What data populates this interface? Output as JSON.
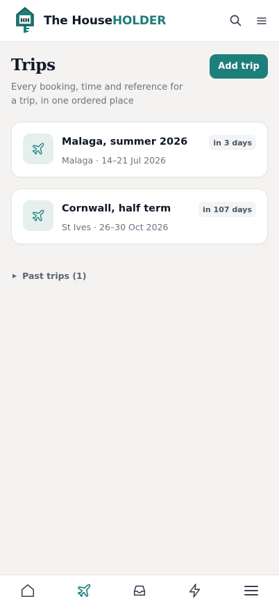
{
  "header": {
    "brand_part1": "The House",
    "brand_part2": "HOLDER",
    "logo_letters": "HH",
    "icons": [
      "search-icon",
      "menu-icon"
    ]
  },
  "page": {
    "title": "Trips",
    "subtitle": "Every booking, time and reference for a trip, in one ordered place",
    "add_button": "Add trip"
  },
  "trips": [
    {
      "name": "Malaga, summer 2026",
      "meta": "Malaga · 14–21 Jul 2026",
      "badge": "in 3 days",
      "icon": "plane-icon"
    },
    {
      "name": "Cornwall, half term",
      "meta": "St Ives · 26–30 Oct 2026",
      "badge": "in 107 days",
      "icon": "plane-icon"
    }
  ],
  "past_trips": {
    "label": "Past trips (1)"
  },
  "bottom_nav": {
    "items": [
      "home-icon",
      "plane-icon",
      "inbox-icon",
      "lightning-icon",
      "menu-icon"
    ],
    "active": "plane-icon"
  },
  "colors": {
    "accent": "#1c7f7a",
    "background": "#f4f3f1",
    "text": "#111827",
    "muted": "#6b7280"
  }
}
